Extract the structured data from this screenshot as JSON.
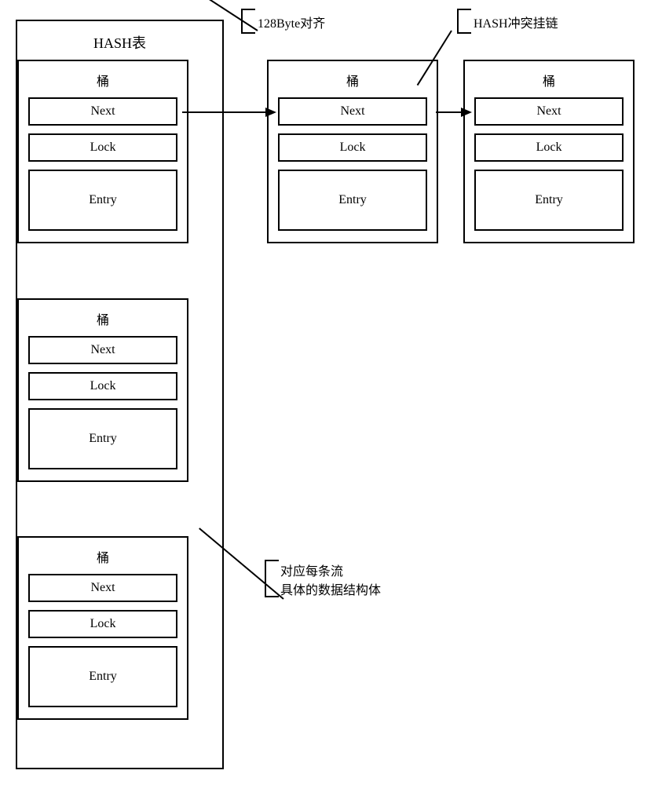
{
  "hash_table": {
    "title": "HASH表",
    "buckets": [
      {
        "title": "桶",
        "next": "Next",
        "lock": "Lock",
        "entry": "Entry"
      },
      {
        "title": "桶",
        "next": "Next",
        "lock": "Lock",
        "entry": "Entry"
      },
      {
        "title": "桶",
        "next": "Next",
        "lock": "Lock",
        "entry": "Entry"
      }
    ]
  },
  "chain": [
    {
      "title": "桶",
      "next": "Next",
      "lock": "Lock",
      "entry": "Entry"
    },
    {
      "title": "桶",
      "next": "Next",
      "lock": "Lock",
      "entry": "Entry"
    }
  ],
  "callouts": {
    "alignment": "128Byte对齐",
    "hash_chain": "HASH冲突挂链",
    "entry_desc_line1": "对应每条流",
    "entry_desc_line2": "具体的数据结构体"
  }
}
